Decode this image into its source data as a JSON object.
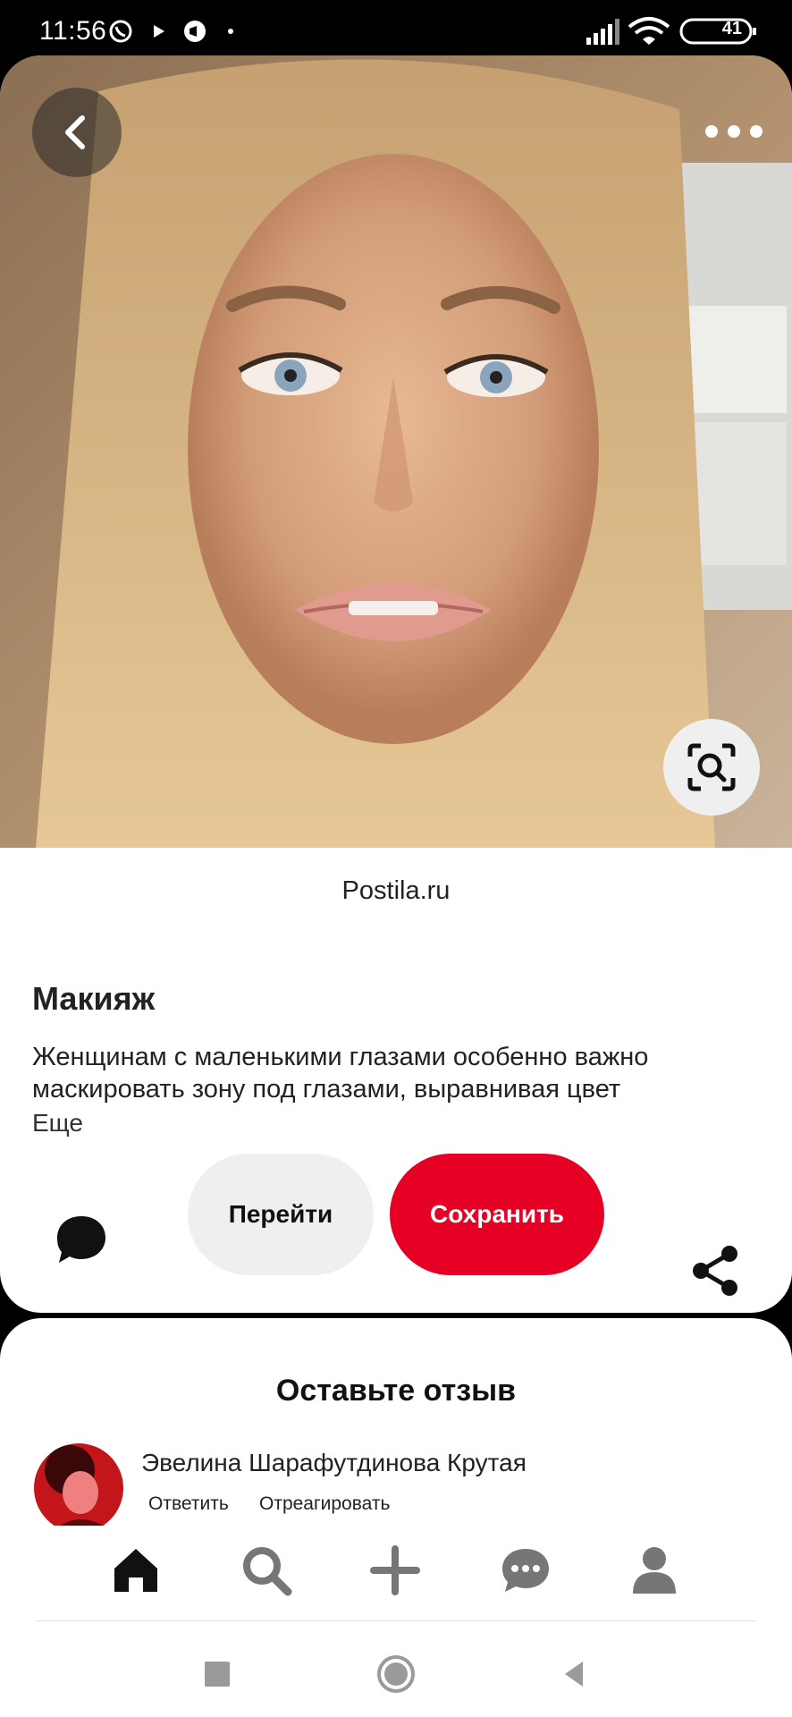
{
  "status_bar": {
    "time": "11:56",
    "battery": "41"
  },
  "pin": {
    "source": "Postila.ru",
    "title": "Макияж",
    "description": "Женщинам с маленькими глазами особенно важно маскировать зону под глазами, выравнивая цвет",
    "more_label": "Еще",
    "visit_label": "Перейти",
    "save_label": "Сохранить"
  },
  "comments": {
    "heading": "Оставьте отзыв",
    "author": "Эвелина Шарафутдинова Крутая",
    "reply_label": "Ответить",
    "react_label": "Отреагировать"
  },
  "colors": {
    "save_red": "#e60023",
    "pill_gray": "#efefef"
  },
  "icons": [
    "back-icon",
    "more-icon",
    "visual-search-icon",
    "comment-icon",
    "share-icon",
    "home-icon",
    "search-icon",
    "add-icon",
    "messages-icon",
    "profile-icon"
  ]
}
